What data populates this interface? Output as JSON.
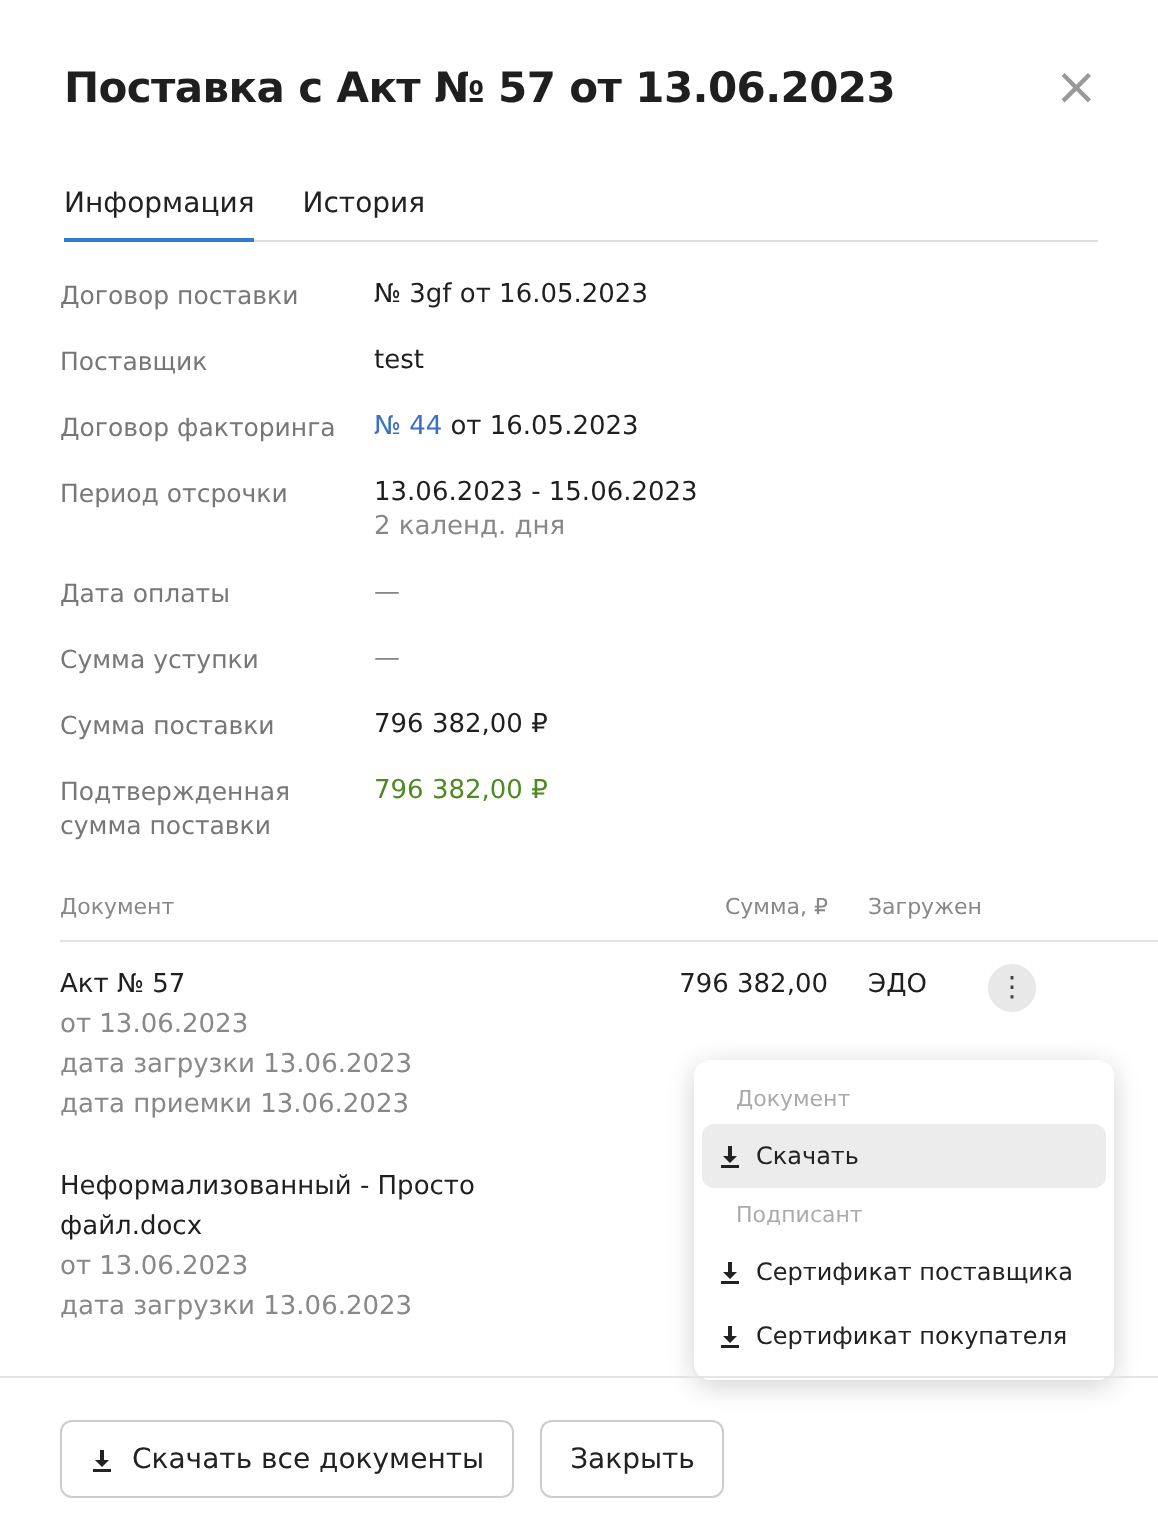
{
  "dialog": {
    "title": "Поставка с Акт № 57 от 13.06.2023",
    "close": "×"
  },
  "tabs": [
    {
      "label": "Информация",
      "selected": true
    },
    {
      "label": "История",
      "selected": false
    }
  ],
  "details": [
    {
      "label": "Договор поставки",
      "value": "№ 3gf от 16.05.2023"
    },
    {
      "label": "Поставщик",
      "value": "test"
    },
    {
      "label": "Договор факторинга",
      "link": "№ 44",
      "value": "от 16.05.2023"
    },
    {
      "label": "Период отсрочки",
      "value": "13.06.2023 - 15.06.2023",
      "note": "2 календ. дня"
    },
    {
      "label": "Дата оплаты",
      "value": "—",
      "empty": true
    },
    {
      "label": "Сумма уступки",
      "value": "—",
      "empty": true
    },
    {
      "label": "Сумма поставки",
      "value": "796 382,00 ₽"
    },
    {
      "label": "Подтвержденная сумма поставки",
      "value": "796 382,00 ₽",
      "confirmed": true
    }
  ],
  "documents": {
    "columns": [
      "Документ",
      "Сумма, ₽",
      "Загружен"
    ],
    "rows": [
      {
        "name": "Акт № 57",
        "lines": [
          "от 13.06.2023",
          "дата загрузки 13.06.2023",
          "дата приемки 13.06.2023"
        ],
        "sum": "796 382,00",
        "source": "ЭДО",
        "menu_button": "⋮"
      },
      {
        "name": "Неформализованный - Просто файл.docx",
        "lines": [
          "от 13.06.2023",
          "дата загрузки 13.06.2023"
        ]
      }
    ]
  },
  "menu": {
    "sections": [
      {
        "title": "Документ",
        "items": [
          {
            "label": "Скачать",
            "highlighted": true
          }
        ]
      },
      {
        "title": "Подписант",
        "items": [
          {
            "label": "Сертификат поставщика",
            "highlighted": false
          },
          {
            "label": "Сертификат покупателя",
            "highlighted": false
          }
        ]
      }
    ]
  },
  "footer": {
    "buttons": [
      {
        "label": "Скачать все документы",
        "kind": "download"
      },
      {
        "label": "Закрыть",
        "kind": "plain"
      }
    ]
  }
}
